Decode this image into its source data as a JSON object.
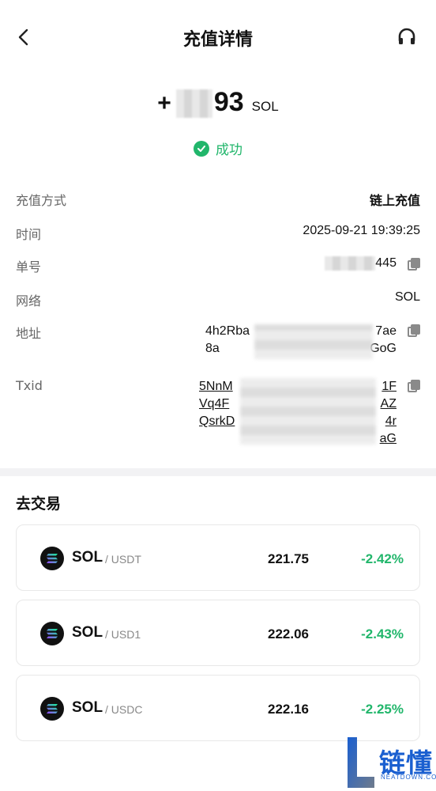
{
  "header": {
    "title": "充值详情"
  },
  "amount": {
    "sign": "+",
    "visible_digits": "93",
    "unit": "SOL"
  },
  "status": {
    "text": "成功"
  },
  "details": {
    "method_label": "充值方式",
    "method_value": "链上充值",
    "time_label": "时间",
    "time_value": "2025-09-21 19:39:25",
    "order_label": "单号",
    "order_value": "445",
    "network_label": "网络",
    "network_value": "SOL",
    "address_label": "地址",
    "address_line1": "4h2Rba",
    "address_line1_end": "7ae",
    "address_line2": "8a",
    "address_line2_end": "GoG",
    "txid_label": "Txid",
    "txid_lines": [
      {
        "start": "5NnM",
        "end": "1F"
      },
      {
        "start": "Vq4F",
        "end": "AZ"
      },
      {
        "start": "QsrkD",
        "end": "4r"
      },
      {
        "start": "",
        "end": "aG"
      }
    ]
  },
  "trade": {
    "section_title": "去交易",
    "pairs": [
      {
        "base": "SOL",
        "quote": "/ USDT",
        "price": "221.75",
        "change": "-2.42%"
      },
      {
        "base": "SOL",
        "quote": "/ USD1",
        "price": "222.06",
        "change": "-2.43%"
      },
      {
        "base": "SOL",
        "quote": "/ USDC",
        "price": "222.16",
        "change": "-2.25%"
      }
    ]
  },
  "watermark": {
    "text": "链懂",
    "sub": "NEATDOWN.COM"
  },
  "colors": {
    "success": "#21b66b",
    "label_gray": "#666666",
    "divider": "#f2f2f4"
  }
}
